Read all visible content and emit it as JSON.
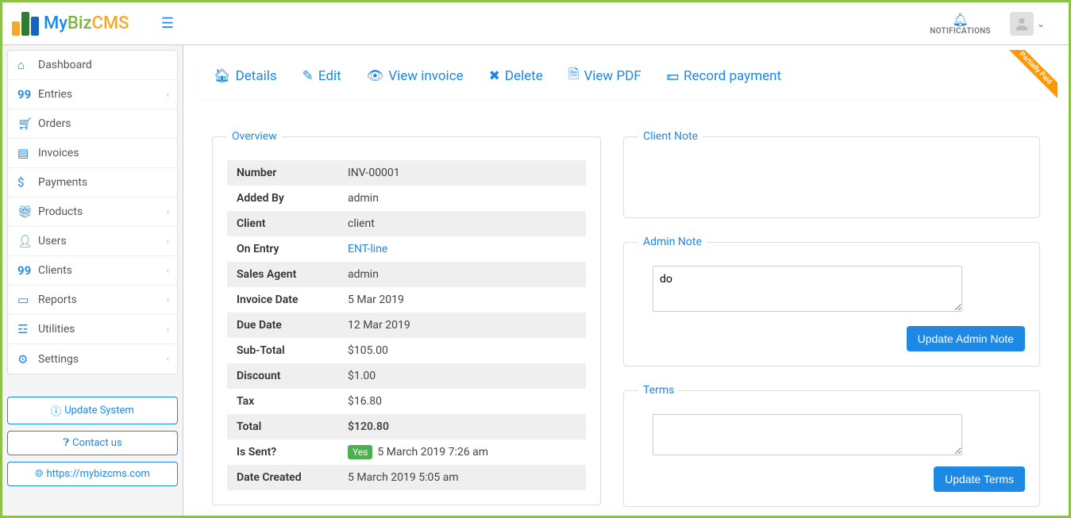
{
  "brand": {
    "my": "My",
    "biz": "Biz",
    "cms": "CMS"
  },
  "header": {
    "notifications": "NOTIFICATIONS"
  },
  "sidebar": {
    "items": [
      {
        "label": "Dashboard",
        "icon": "home",
        "expandable": false
      },
      {
        "label": "Entries",
        "icon": "99",
        "expandable": true
      },
      {
        "label": "Orders",
        "icon": "cart",
        "expandable": false
      },
      {
        "label": "Invoices",
        "icon": "invoice",
        "expandable": false
      },
      {
        "label": "Payments",
        "icon": "dollar",
        "expandable": false
      },
      {
        "label": "Products",
        "icon": "gift",
        "expandable": true
      },
      {
        "label": "Users",
        "icon": "user",
        "expandable": true
      },
      {
        "label": "Clients",
        "icon": "99",
        "expandable": true
      },
      {
        "label": "Reports",
        "icon": "book",
        "expandable": true
      },
      {
        "label": "Utilities",
        "icon": "list",
        "expandable": true
      },
      {
        "label": "Settings",
        "icon": "gear",
        "expandable": true
      }
    ],
    "buttons": {
      "update": "Update System",
      "contact": "Contact us",
      "site": "https://mybizcms.com"
    }
  },
  "actions": {
    "details": "Details",
    "edit": "Edit",
    "view_invoice": "View invoice",
    "delete": "Delete",
    "view_pdf": "View PDF",
    "record_payment": "Record payment",
    "ribbon": "Partially Paid"
  },
  "overview": {
    "title": "Overview",
    "rows": [
      {
        "label": "Number",
        "value": "INV-00001"
      },
      {
        "label": "Added By",
        "value": "admin"
      },
      {
        "label": "Client",
        "value": "client"
      },
      {
        "label": "On Entry",
        "value": "ENT-line",
        "link": true
      },
      {
        "label": "Sales Agent",
        "value": "admin"
      },
      {
        "label": "Invoice Date",
        "value": "5 Mar 2019"
      },
      {
        "label": "Due Date",
        "value": "12 Mar 2019"
      },
      {
        "label": "Sub-Total",
        "value": "$105.00"
      },
      {
        "label": "Discount",
        "value": "$1.00"
      },
      {
        "label": "Tax",
        "value": "$16.80"
      },
      {
        "label": "Total",
        "value": "$120.80",
        "bold": true
      },
      {
        "label": "Is Sent?",
        "value": "5 March 2019 7:26 am",
        "yes": true,
        "yes_label": "Yes"
      },
      {
        "label": "Date Created",
        "value": "5 March 2019 5:05 am"
      }
    ]
  },
  "client_note": {
    "title": "Client Note",
    "value": ""
  },
  "admin_note": {
    "title": "Admin Note",
    "value": "do",
    "button": "Update Admin Note"
  },
  "terms": {
    "title": "Terms",
    "value": "",
    "button": "Update Terms"
  }
}
